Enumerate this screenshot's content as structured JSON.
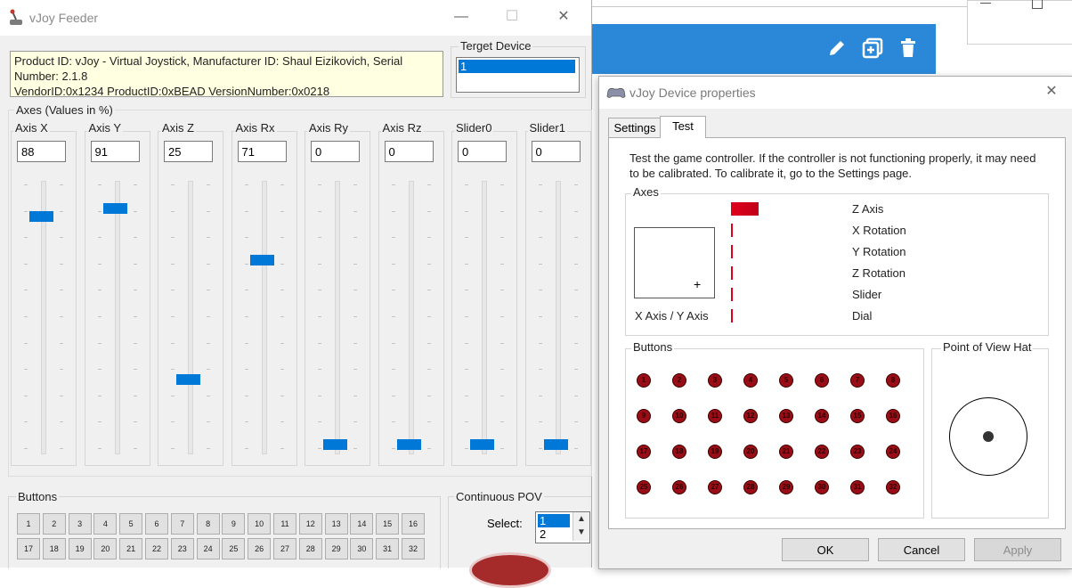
{
  "background": {
    "tool_icons": [
      "pencil-icon",
      "add-copy-icon",
      "trash-icon"
    ],
    "accent": "#2b88d8"
  },
  "feeder": {
    "title": "vJoy Feeder",
    "product_info_line1": "Product ID: vJoy - Virtual Joystick, Manufacturer ID: Shaul Eizikovich, Serial",
    "product_info_line2": "Number: 2.1.8",
    "product_info_line3": "VendorID:0x1234 ProductID:0xBEAD VersionNumber:0x0218",
    "target_device_label": "Terget Device",
    "target_device_value": "1",
    "axes_group_label": "Axes (Values in %)",
    "axes": [
      {
        "name": "Axis X",
        "value": "88",
        "level": 88
      },
      {
        "name": "Axis Y",
        "value": "91",
        "level": 91
      },
      {
        "name": "Axis Z",
        "value": "25",
        "level": 25
      },
      {
        "name": "Axis Rx",
        "value": "71",
        "level": 71
      },
      {
        "name": "Axis Ry",
        "value": "0",
        "level": 0
      },
      {
        "name": "Axis Rz",
        "value": "0",
        "level": 0
      },
      {
        "name": "Slider0",
        "value": "0",
        "level": 0
      },
      {
        "name": "Slider1",
        "value": "0",
        "level": 0
      }
    ],
    "buttons_group_label": "Buttons",
    "buttons": [
      "1",
      "2",
      "3",
      "4",
      "5",
      "6",
      "7",
      "8",
      "9",
      "10",
      "11",
      "12",
      "13",
      "14",
      "15",
      "16",
      "17",
      "18",
      "19",
      "20",
      "21",
      "22",
      "23",
      "24",
      "25",
      "26",
      "27",
      "28",
      "29",
      "30",
      "31",
      "32"
    ],
    "pov_group_label": "Continuous POV",
    "pov_select_label": "Select:",
    "pov_options": [
      "1",
      "2"
    ],
    "pov_selected": "1"
  },
  "props": {
    "title": "vJoy Device properties",
    "tabs": [
      "Settings",
      "Test"
    ],
    "active_tab": "Test",
    "description_line1": "Test the game controller.  If the controller is not functioning properly, it may need",
    "description_line2": "to be calibrated.  To calibrate it, go to the Settings page.",
    "axes_group_label": "Axes",
    "xy_label": "X Axis / Y Axis",
    "axis_rows": [
      {
        "label": "Z Axis",
        "level": 25
      },
      {
        "label": "X Rotation",
        "level": 0
      },
      {
        "label": "Y Rotation",
        "level": 0
      },
      {
        "label": "Z Rotation",
        "level": 0
      },
      {
        "label": "Slider",
        "level": 0
      },
      {
        "label": "Dial",
        "level": 0
      }
    ],
    "buttons_group_label": "Buttons",
    "button_leds": [
      "1",
      "2",
      "3",
      "4",
      "5",
      "6",
      "7",
      "8",
      "9",
      "10",
      "11",
      "12",
      "13",
      "14",
      "15",
      "16",
      "17",
      "18",
      "19",
      "20",
      "21",
      "22",
      "23",
      "24",
      "25",
      "26",
      "27",
      "28",
      "29",
      "30",
      "31",
      "32"
    ],
    "pov_group_label": "Point of View Hat",
    "ok_label": "OK",
    "cancel_label": "Cancel",
    "apply_label": "Apply",
    "led_color": "#9b0d16",
    "bar_color": "#e0001b"
  }
}
